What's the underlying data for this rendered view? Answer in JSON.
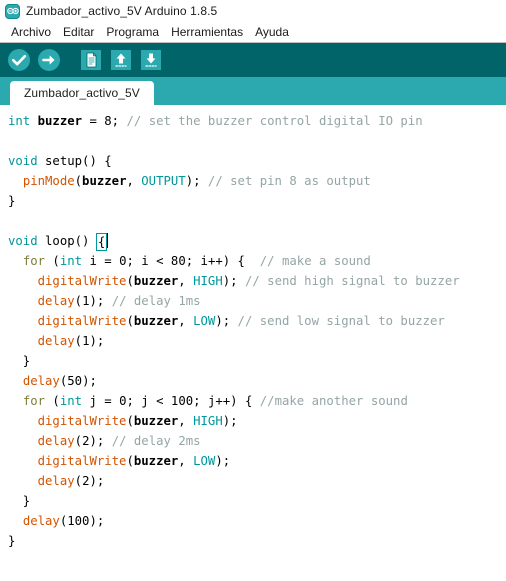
{
  "window": {
    "title": "Zumbador_activo_5V Arduino 1.8.5",
    "logo_icon": "arduino-infinity-icon"
  },
  "menubar": {
    "items": [
      {
        "label": "Archivo"
      },
      {
        "label": "Editar"
      },
      {
        "label": "Programa"
      },
      {
        "label": "Herramientas"
      },
      {
        "label": "Ayuda"
      }
    ]
  },
  "toolbar": {
    "background": "#006468",
    "buttons": [
      {
        "name": "verify-button",
        "icon": "check-circle-icon",
        "label": "Verificar"
      },
      {
        "name": "upload-button",
        "icon": "arrow-right-circle-icon",
        "label": "Subir"
      },
      {
        "name": "new-button",
        "icon": "new-document-icon",
        "label": "Nuevo"
      },
      {
        "name": "open-button",
        "icon": "arrow-up-icon",
        "label": "Abrir"
      },
      {
        "name": "save-button",
        "icon": "arrow-down-icon",
        "label": "Guardar"
      }
    ]
  },
  "tabs": {
    "background": "#2ba9ae",
    "items": [
      {
        "label": "Zumbador_activo_5V",
        "active": true
      }
    ]
  },
  "editor": {
    "lines": [
      [
        {
          "t": "type",
          "s": "int"
        },
        {
          "t": "plain",
          "s": " "
        },
        {
          "t": "ident",
          "s": "buzzer"
        },
        {
          "t": "plain",
          "s": " = "
        },
        {
          "t": "num",
          "s": "8"
        },
        {
          "t": "plain",
          "s": "; "
        },
        {
          "t": "comment",
          "s": "// set the buzzer control digital IO pin"
        }
      ],
      [],
      [
        {
          "t": "type",
          "s": "void"
        },
        {
          "t": "plain",
          "s": " setup() {"
        }
      ],
      [
        {
          "t": "plain",
          "s": "  "
        },
        {
          "t": "func",
          "s": "pinMode"
        },
        {
          "t": "plain",
          "s": "("
        },
        {
          "t": "ident",
          "s": "buzzer"
        },
        {
          "t": "plain",
          "s": ", "
        },
        {
          "t": "const",
          "s": "OUTPUT"
        },
        {
          "t": "plain",
          "s": "); "
        },
        {
          "t": "comment",
          "s": "// set pin 8 as output"
        }
      ],
      [
        {
          "t": "plain",
          "s": "}"
        }
      ],
      [],
      [
        {
          "t": "type",
          "s": "void"
        },
        {
          "t": "plain",
          "s": " loop() "
        },
        {
          "t": "bracket",
          "s": "{"
        }
      ],
      [
        {
          "t": "plain",
          "s": "  "
        },
        {
          "t": "kw",
          "s": "for"
        },
        {
          "t": "plain",
          "s": " ("
        },
        {
          "t": "type",
          "s": "int"
        },
        {
          "t": "plain",
          "s": " i = "
        },
        {
          "t": "num",
          "s": "0"
        },
        {
          "t": "plain",
          "s": "; i < "
        },
        {
          "t": "num",
          "s": "80"
        },
        {
          "t": "plain",
          "s": "; i++) {  "
        },
        {
          "t": "comment",
          "s": "// make a sound"
        }
      ],
      [
        {
          "t": "plain",
          "s": "    "
        },
        {
          "t": "func",
          "s": "digitalWrite"
        },
        {
          "t": "plain",
          "s": "("
        },
        {
          "t": "ident",
          "s": "buzzer"
        },
        {
          "t": "plain",
          "s": ", "
        },
        {
          "t": "const",
          "s": "HIGH"
        },
        {
          "t": "plain",
          "s": "); "
        },
        {
          "t": "comment",
          "s": "// send high signal to buzzer"
        }
      ],
      [
        {
          "t": "plain",
          "s": "    "
        },
        {
          "t": "func",
          "s": "delay"
        },
        {
          "t": "plain",
          "s": "("
        },
        {
          "t": "num",
          "s": "1"
        },
        {
          "t": "plain",
          "s": "); "
        },
        {
          "t": "comment",
          "s": "// delay 1ms"
        }
      ],
      [
        {
          "t": "plain",
          "s": "    "
        },
        {
          "t": "func",
          "s": "digitalWrite"
        },
        {
          "t": "plain",
          "s": "("
        },
        {
          "t": "ident",
          "s": "buzzer"
        },
        {
          "t": "plain",
          "s": ", "
        },
        {
          "t": "const",
          "s": "LOW"
        },
        {
          "t": "plain",
          "s": "); "
        },
        {
          "t": "comment",
          "s": "// send low signal to buzzer"
        }
      ],
      [
        {
          "t": "plain",
          "s": "    "
        },
        {
          "t": "func",
          "s": "delay"
        },
        {
          "t": "plain",
          "s": "("
        },
        {
          "t": "num",
          "s": "1"
        },
        {
          "t": "plain",
          "s": ");"
        }
      ],
      [
        {
          "t": "plain",
          "s": "  }"
        }
      ],
      [
        {
          "t": "plain",
          "s": "  "
        },
        {
          "t": "func",
          "s": "delay"
        },
        {
          "t": "plain",
          "s": "("
        },
        {
          "t": "num",
          "s": "50"
        },
        {
          "t": "plain",
          "s": ");"
        }
      ],
      [
        {
          "t": "plain",
          "s": "  "
        },
        {
          "t": "kw",
          "s": "for"
        },
        {
          "t": "plain",
          "s": " ("
        },
        {
          "t": "type",
          "s": "int"
        },
        {
          "t": "plain",
          "s": " j = "
        },
        {
          "t": "num",
          "s": "0"
        },
        {
          "t": "plain",
          "s": "; j < "
        },
        {
          "t": "num",
          "s": "100"
        },
        {
          "t": "plain",
          "s": "; j++) { "
        },
        {
          "t": "comment",
          "s": "//make another sound"
        }
      ],
      [
        {
          "t": "plain",
          "s": "    "
        },
        {
          "t": "func",
          "s": "digitalWrite"
        },
        {
          "t": "plain",
          "s": "("
        },
        {
          "t": "ident",
          "s": "buzzer"
        },
        {
          "t": "plain",
          "s": ", "
        },
        {
          "t": "const",
          "s": "HIGH"
        },
        {
          "t": "plain",
          "s": ");"
        }
      ],
      [
        {
          "t": "plain",
          "s": "    "
        },
        {
          "t": "func",
          "s": "delay"
        },
        {
          "t": "plain",
          "s": "("
        },
        {
          "t": "num",
          "s": "2"
        },
        {
          "t": "plain",
          "s": "); "
        },
        {
          "t": "comment",
          "s": "// delay 2ms"
        }
      ],
      [
        {
          "t": "plain",
          "s": "    "
        },
        {
          "t": "func",
          "s": "digitalWrite"
        },
        {
          "t": "plain",
          "s": "("
        },
        {
          "t": "ident",
          "s": "buzzer"
        },
        {
          "t": "plain",
          "s": ", "
        },
        {
          "t": "const",
          "s": "LOW"
        },
        {
          "t": "plain",
          "s": ");"
        }
      ],
      [
        {
          "t": "plain",
          "s": "    "
        },
        {
          "t": "func",
          "s": "delay"
        },
        {
          "t": "plain",
          "s": "("
        },
        {
          "t": "num",
          "s": "2"
        },
        {
          "t": "plain",
          "s": ");"
        }
      ],
      [
        {
          "t": "plain",
          "s": "  }"
        }
      ],
      [
        {
          "t": "plain",
          "s": "  "
        },
        {
          "t": "func",
          "s": "delay"
        },
        {
          "t": "plain",
          "s": "("
        },
        {
          "t": "num",
          "s": "100"
        },
        {
          "t": "plain",
          "s": ");"
        }
      ],
      [
        {
          "t": "plain",
          "s": "}"
        }
      ]
    ]
  },
  "colors": {
    "toolbar_bg": "#006468",
    "tabstrip_bg": "#2ba9ae",
    "accent": "#00979c",
    "function": "#d35400",
    "comment": "#95a5a6",
    "keyword": "#7e7e3c"
  }
}
